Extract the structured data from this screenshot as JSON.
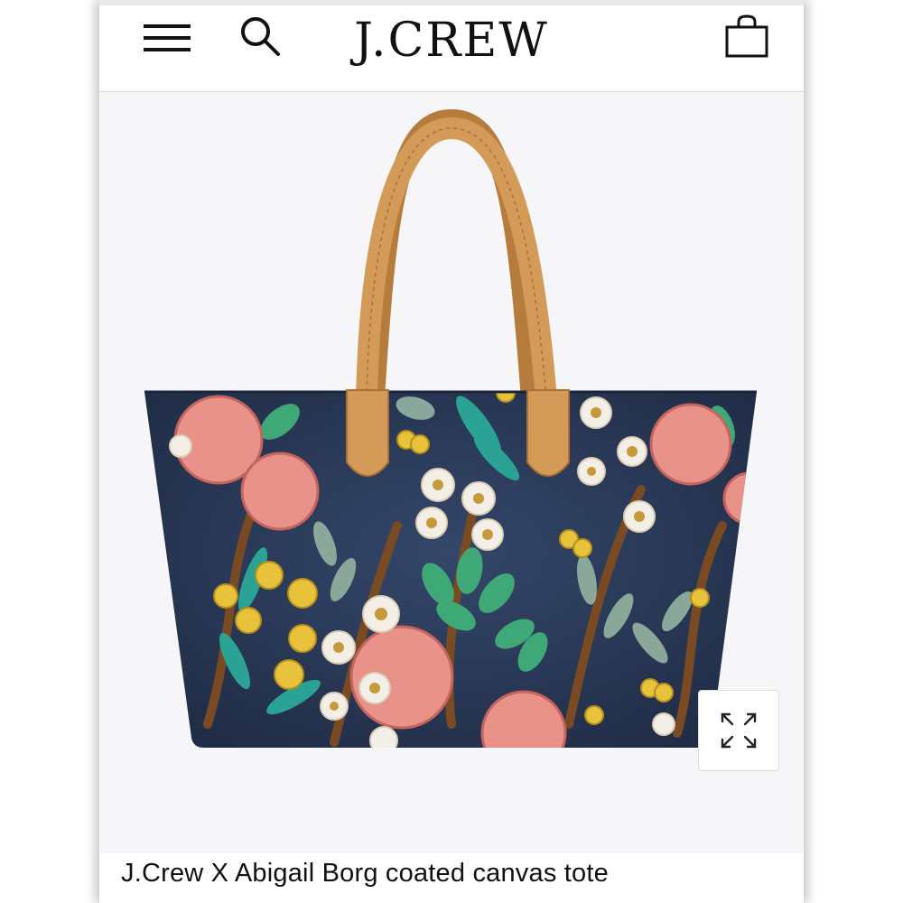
{
  "header": {
    "logo": "J.CREW",
    "icons": {
      "menu": "hamburger-menu-icon",
      "search": "search-icon",
      "cart": "shopping-bag-icon"
    }
  },
  "product": {
    "name": "J.Crew X Abigail Borg coated canvas tote",
    "image_icon": "expand-arrows-icon"
  },
  "colors": {
    "background": "#f6f6f8",
    "tote_canvas": "#2e3e5c",
    "strap": "#d39a58",
    "pink_flower": "#e9928a",
    "green_leaf": "#3fa877",
    "teal_leaf": "#2aa394",
    "yellow_flower": "#e8c23a"
  }
}
